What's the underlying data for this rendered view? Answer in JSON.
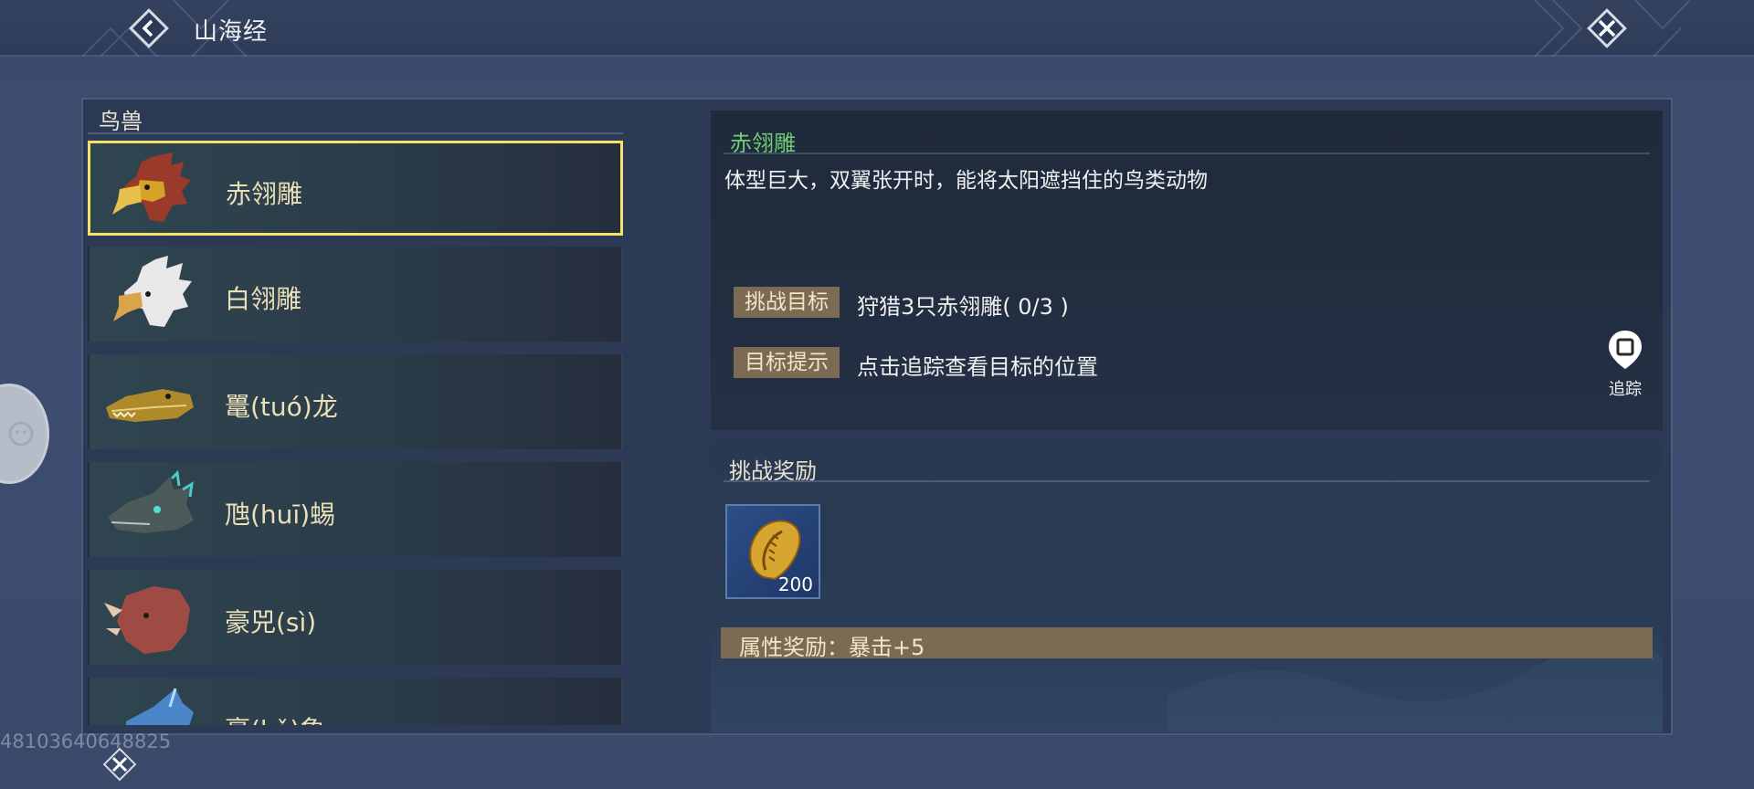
{
  "header": {
    "title": "山海经"
  },
  "category": {
    "title": "鸟兽"
  },
  "list": {
    "items": [
      {
        "name": "赤翎雕",
        "icon": "red-eagle-portrait",
        "selected": true
      },
      {
        "name": "白翎雕",
        "icon": "white-eagle-portrait",
        "selected": false
      },
      {
        "name": "鼍(tuó)龙",
        "icon": "crocodile-portrait",
        "selected": false
      },
      {
        "name": "虺(huī)蜴",
        "icon": "lizard-portrait",
        "selected": false
      },
      {
        "name": "豪兕(sì)",
        "icon": "rhino-portrait",
        "selected": false
      },
      {
        "name": "豪(kě)象",
        "icon": "blue-beast-portrait",
        "selected": false
      }
    ]
  },
  "detail": {
    "name": "赤翎雕",
    "description": "体型巨大，双翼张开时，能将太阳遮挡住的鸟类动物",
    "goal_tag": "挑战目标",
    "goal_text": "狩猎3只赤翎雕( 0/3 )",
    "hint_tag": "目标提示",
    "hint_text": "点击追踪查看目标的位置",
    "track_label": "追踪"
  },
  "reward": {
    "title": "挑战奖励",
    "item_icon": "golden-shell-icon",
    "item_count": "200",
    "attr_text": "属性奖励：暴击+5"
  },
  "misc": {
    "watermark": "48103640648825"
  },
  "colors": {
    "selected_border": "#f3e36a",
    "name_green": "#6fcd73",
    "tag_bg": "#7c6a55"
  }
}
